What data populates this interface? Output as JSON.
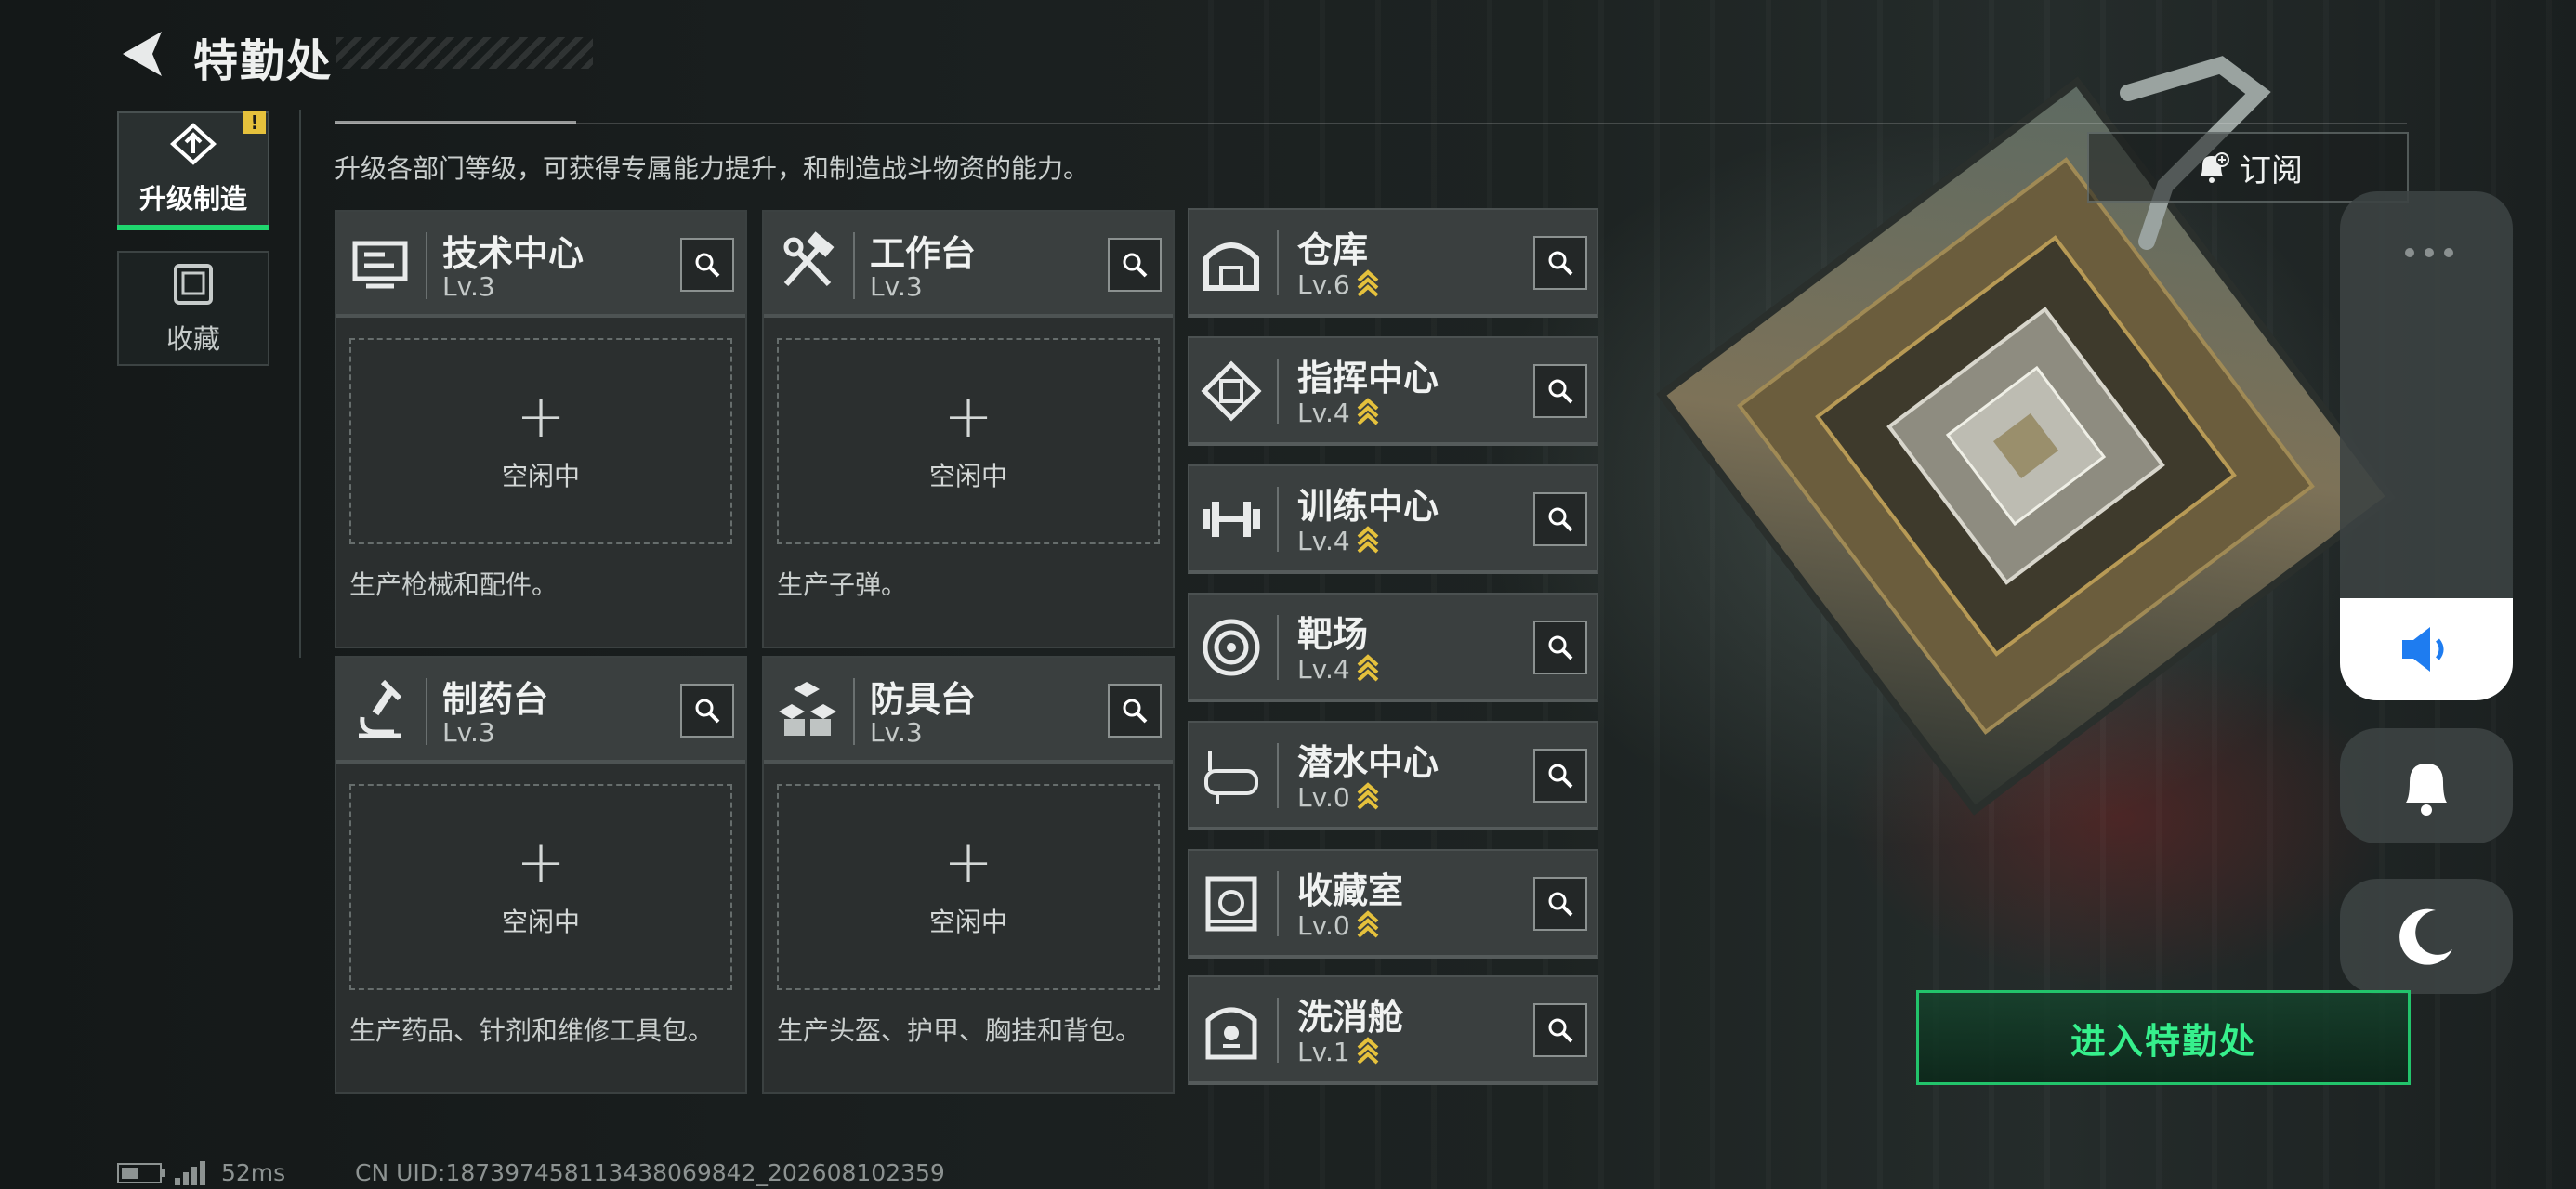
{
  "header": {
    "title": "特勤处"
  },
  "sidebar": {
    "tabs": [
      {
        "label": "升级制造",
        "icon": "upgrade-icon",
        "active": true,
        "badge": "!"
      },
      {
        "label": "收藏",
        "icon": "collection-cabinet-icon",
        "active": false
      }
    ]
  },
  "description": "升级各部门等级，可获得专属能力提升，和制造战斗物资的能力。",
  "production": [
    {
      "name": "技术中心",
      "level": "Lv.3",
      "icon": "tech-center-icon",
      "slot_label": "空闲中",
      "desc": "生产枪械和配件。"
    },
    {
      "name": "工作台",
      "level": "Lv.3",
      "icon": "workbench-icon",
      "slot_label": "空闲中",
      "desc": "生产子弹。"
    },
    {
      "name": "制药台",
      "level": "Lv.3",
      "icon": "pharmacy-icon",
      "slot_label": "空闲中",
      "desc": "生产药品、针剂和维修工具包。"
    },
    {
      "name": "防具台",
      "level": "Lv.3",
      "icon": "armor-bench-icon",
      "slot_label": "空闲中",
      "desc": "生产头盔、护甲、胸挂和背包。"
    }
  ],
  "facilities": [
    {
      "name": "仓库",
      "level": "Lv.6",
      "icon": "warehouse-icon"
    },
    {
      "name": "指挥中心",
      "level": "Lv.4",
      "icon": "command-center-icon"
    },
    {
      "name": "训练中心",
      "level": "Lv.4",
      "icon": "training-center-icon"
    },
    {
      "name": "靶场",
      "level": "Lv.4",
      "icon": "shooting-range-icon"
    },
    {
      "name": "潜水中心",
      "level": "Lv.0",
      "icon": "diving-center-icon"
    },
    {
      "name": "收藏室",
      "level": "Lv.0",
      "icon": "collection-room-icon"
    },
    {
      "name": "洗消舱",
      "level": "Lv.1",
      "icon": "decontamination-icon"
    }
  ],
  "subscribe": {
    "label": "订阅"
  },
  "enter_button": {
    "label": "进入特勤处"
  },
  "overlay_panel": {
    "volume": 0.2
  },
  "footer": {
    "ping": "52ms",
    "uid": "CN UID:1873974581134380698​42_202608102359"
  },
  "colors": {
    "accent_green": "#22c46b",
    "upgrade_yellow": "#e5c13c"
  }
}
